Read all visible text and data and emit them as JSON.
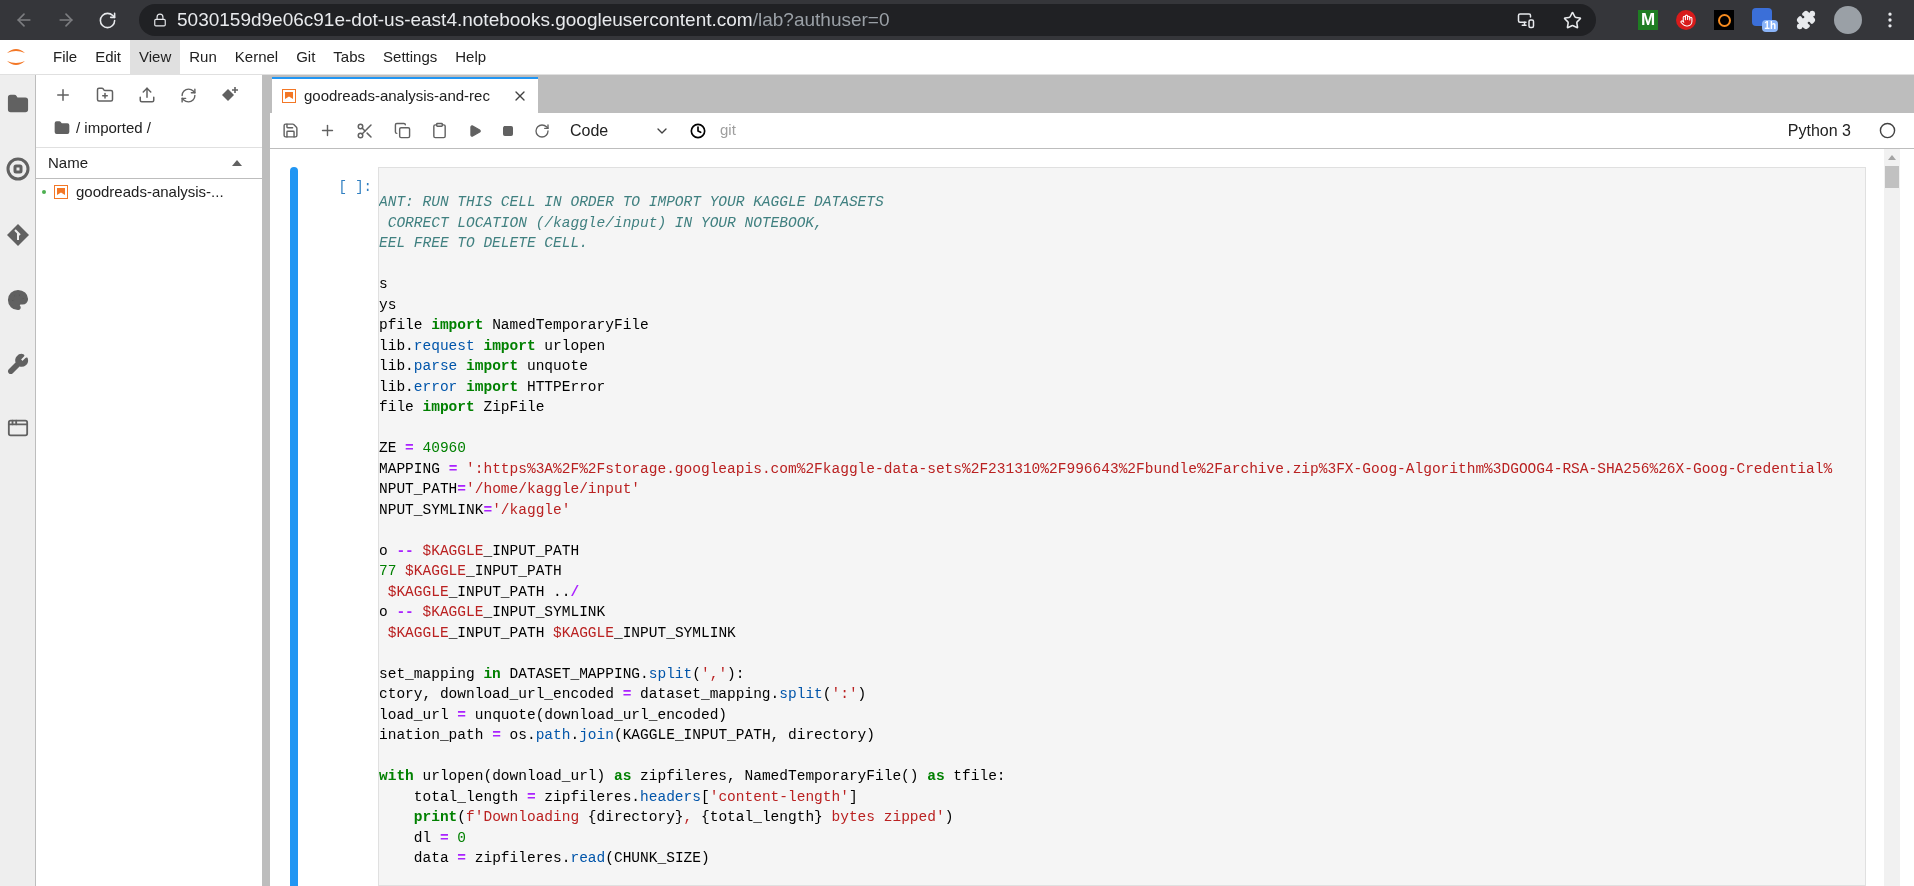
{
  "browser": {
    "url_host": "5030159d9e06c91e-dot-us-east4.notebooks.googleusercontent.com",
    "url_path": "/lab?authuser=0",
    "extensions": [
      {
        "kind": "letter",
        "text": "M"
      },
      {
        "kind": "hand"
      },
      {
        "kind": "ring"
      },
      {
        "kind": "calendar",
        "badge": "1h"
      },
      {
        "kind": "puzzle"
      }
    ]
  },
  "menu": [
    {
      "label": "File",
      "selected": false
    },
    {
      "label": "Edit",
      "selected": false
    },
    {
      "label": "View",
      "selected": true
    },
    {
      "label": "Run",
      "selected": false
    },
    {
      "label": "Kernel",
      "selected": false
    },
    {
      "label": "Git",
      "selected": false
    },
    {
      "label": "Tabs",
      "selected": false
    },
    {
      "label": "Settings",
      "selected": false
    },
    {
      "label": "Help",
      "selected": false
    }
  ],
  "file_browser": {
    "breadcrumb": "/ imported /",
    "column": "Name",
    "items": [
      {
        "name": "goodreads-analysis-...",
        "running": true
      }
    ]
  },
  "tabs": [
    {
      "label": "goodreads-analysis-and-rec",
      "selected": true
    }
  ],
  "toolbar": {
    "cell_type": "Code",
    "git": "git",
    "kernel": "Python 3"
  },
  "cell": {
    "prompt": "[ ]:",
    "lines": [
      {
        "kind": "code",
        "tokens": [
          {
            "text": "ANT: RUN THIS CELL IN ORDER TO IMPORT YOUR KAGGLE DATASETS",
            "kind": "comment"
          }
        ]
      },
      {
        "kind": "code",
        "tokens": [
          {
            "text": " CORRECT LOCATION (/kaggle/input) IN YOUR NOTEBOOK,",
            "kind": "comment"
          }
        ]
      },
      {
        "kind": "code",
        "tokens": [
          {
            "text": "EEL FREE TO DELETE CELL.",
            "kind": "comment"
          }
        ]
      },
      {
        "kind": "blank"
      },
      {
        "kind": "code",
        "tokens": [
          {
            "text": "s",
            "kind": "plain"
          }
        ]
      },
      {
        "kind": "code",
        "tokens": [
          {
            "text": "ys",
            "kind": "plain"
          }
        ]
      },
      {
        "kind": "code",
        "tokens": [
          {
            "text": "pfile ",
            "kind": "plain"
          },
          {
            "text": "import",
            "kind": "keyword"
          },
          {
            "text": " NamedTemporaryFile",
            "kind": "plain"
          }
        ]
      },
      {
        "kind": "code",
        "tokens": [
          {
            "text": "lib.",
            "kind": "plain"
          },
          {
            "text": "request ",
            "kind": "attr"
          },
          {
            "text": "import",
            "kind": "keyword"
          },
          {
            "text": " urlopen",
            "kind": "plain"
          }
        ]
      },
      {
        "kind": "code",
        "tokens": [
          {
            "text": "lib.",
            "kind": "plain"
          },
          {
            "text": "parse ",
            "kind": "attr"
          },
          {
            "text": "import",
            "kind": "keyword"
          },
          {
            "text": " unquote",
            "kind": "plain"
          }
        ]
      },
      {
        "kind": "code",
        "tokens": [
          {
            "text": "lib.",
            "kind": "plain"
          },
          {
            "text": "error ",
            "kind": "attr"
          },
          {
            "text": "import",
            "kind": "keyword"
          },
          {
            "text": " HTTPError",
            "kind": "plain"
          }
        ]
      },
      {
        "kind": "code",
        "tokens": [
          {
            "text": "file ",
            "kind": "plain"
          },
          {
            "text": "import",
            "kind": "keyword"
          },
          {
            "text": " ZipFile",
            "kind": "plain"
          }
        ]
      },
      {
        "kind": "blank"
      },
      {
        "kind": "code",
        "tokens": [
          {
            "text": "ZE ",
            "kind": "plain"
          },
          {
            "text": "= ",
            "kind": "operator"
          },
          {
            "text": "40960",
            "kind": "number"
          }
        ]
      },
      {
        "kind": "code",
        "tokens": [
          {
            "text": "MAPPING ",
            "kind": "plain"
          },
          {
            "text": "= ",
            "kind": "operator"
          },
          {
            "text": "':https%3A%2F%2Fstorage.googleapis.com%2Fkaggle-data-sets%2F231310%2F996643%2Fbundle%2Farchive.zip%3FX-Goog-Algorithm%3DGOOG4-RSA-SHA256%26X-Goog-Credential%",
            "kind": "string"
          }
        ]
      },
      {
        "kind": "code",
        "tokens": [
          {
            "text": "NPUT_PATH",
            "kind": "plain"
          },
          {
            "text": "=",
            "kind": "operator"
          },
          {
            "text": "'/home/kaggle/input'",
            "kind": "string"
          }
        ]
      },
      {
        "kind": "code",
        "tokens": [
          {
            "text": "NPUT_SYMLINK",
            "kind": "plain"
          },
          {
            "text": "=",
            "kind": "operator"
          },
          {
            "text": "'/kaggle'",
            "kind": "string"
          }
        ]
      },
      {
        "kind": "blank"
      },
      {
        "kind": "code",
        "tokens": [
          {
            "text": "o ",
            "kind": "plain"
          },
          {
            "text": "-- ",
            "kind": "operator"
          },
          {
            "text": "$KAGGLE",
            "kind": "string"
          },
          {
            "text": "_INPUT_PATH",
            "kind": "plain"
          }
        ]
      },
      {
        "kind": "code",
        "tokens": [
          {
            "text": "77 ",
            "kind": "number"
          },
          {
            "text": "$KAGGLE",
            "kind": "string"
          },
          {
            "text": "_INPUT_PATH",
            "kind": "plain"
          }
        ]
      },
      {
        "kind": "code",
        "tokens": [
          {
            "text": " $KAGGLE",
            "kind": "string"
          },
          {
            "text": "_INPUT_PATH ..",
            "kind": "plain"
          },
          {
            "text": "/",
            "kind": "operator"
          }
        ]
      },
      {
        "kind": "code",
        "tokens": [
          {
            "text": "o ",
            "kind": "plain"
          },
          {
            "text": "-- ",
            "kind": "operator"
          },
          {
            "text": "$KAGGLE",
            "kind": "string"
          },
          {
            "text": "_INPUT_SYMLINK",
            "kind": "plain"
          }
        ]
      },
      {
        "kind": "code",
        "tokens": [
          {
            "text": " $KAGGLE",
            "kind": "string"
          },
          {
            "text": "_INPUT_PATH ",
            "kind": "plain"
          },
          {
            "text": "$KAGGLE",
            "kind": "string"
          },
          {
            "text": "_INPUT_SYMLINK",
            "kind": "plain"
          }
        ]
      },
      {
        "kind": "blank"
      },
      {
        "kind": "code",
        "tokens": [
          {
            "text": "set_mapping ",
            "kind": "plain"
          },
          {
            "text": "in",
            "kind": "keyword"
          },
          {
            "text": " DATASET_MAPPING.",
            "kind": "plain"
          },
          {
            "text": "split",
            "kind": "attr"
          },
          {
            "text": "(",
            "kind": "plain"
          },
          {
            "text": "','",
            "kind": "string"
          },
          {
            "text": "):",
            "kind": "plain"
          }
        ]
      },
      {
        "kind": "code",
        "tokens": [
          {
            "text": "ctory, download_url_encoded ",
            "kind": "plain"
          },
          {
            "text": "=",
            "kind": "operator"
          },
          {
            "text": " dataset_mapping.",
            "kind": "plain"
          },
          {
            "text": "split",
            "kind": "attr"
          },
          {
            "text": "(",
            "kind": "plain"
          },
          {
            "text": "':'",
            "kind": "string"
          },
          {
            "text": ")",
            "kind": "plain"
          }
        ]
      },
      {
        "kind": "code",
        "tokens": [
          {
            "text": "load_url ",
            "kind": "plain"
          },
          {
            "text": "=",
            "kind": "operator"
          },
          {
            "text": " unquote(download_url_encoded)",
            "kind": "plain"
          }
        ]
      },
      {
        "kind": "code",
        "tokens": [
          {
            "text": "ination_path ",
            "kind": "plain"
          },
          {
            "text": "=",
            "kind": "operator"
          },
          {
            "text": " os.",
            "kind": "plain"
          },
          {
            "text": "path",
            "kind": "attr"
          },
          {
            "text": ".",
            "kind": "plain"
          },
          {
            "text": "join",
            "kind": "attr"
          },
          {
            "text": "(KAGGLE_INPUT_PATH, directory)",
            "kind": "plain"
          }
        ]
      },
      {
        "kind": "blank"
      },
      {
        "kind": "code",
        "tokens": [
          {
            "text": "with",
            "kind": "keyword"
          },
          {
            "text": " urlopen(download_url) ",
            "kind": "plain"
          },
          {
            "text": "as",
            "kind": "keyword"
          },
          {
            "text": " zipfileres, NamedTemporaryFile() ",
            "kind": "plain"
          },
          {
            "text": "as",
            "kind": "keyword"
          },
          {
            "text": " tfile:",
            "kind": "plain"
          }
        ]
      },
      {
        "kind": "code",
        "tokens": [
          {
            "text": "    total_length ",
            "kind": "plain"
          },
          {
            "text": "=",
            "kind": "operator"
          },
          {
            "text": " zipfileres.",
            "kind": "plain"
          },
          {
            "text": "headers",
            "kind": "attr"
          },
          {
            "text": "[",
            "kind": "plain"
          },
          {
            "text": "'content-length'",
            "kind": "string"
          },
          {
            "text": "]",
            "kind": "plain"
          }
        ]
      },
      {
        "kind": "code",
        "tokens": [
          {
            "text": "    print",
            "kind": "keyword"
          },
          {
            "text": "(",
            "kind": "plain"
          },
          {
            "text": "f'Downloading ",
            "kind": "string"
          },
          {
            "text": "{directory}",
            "kind": "plain"
          },
          {
            "text": ", ",
            "kind": "string"
          },
          {
            "text": "{total_length}",
            "kind": "plain"
          },
          {
            "text": " bytes zipped'",
            "kind": "string"
          },
          {
            "text": ")",
            "kind": "plain"
          }
        ]
      },
      {
        "kind": "code",
        "tokens": [
          {
            "text": "    dl ",
            "kind": "plain"
          },
          {
            "text": "= ",
            "kind": "operator"
          },
          {
            "text": "0",
            "kind": "number"
          }
        ]
      },
      {
        "kind": "code",
        "tokens": [
          {
            "text": "    data ",
            "kind": "plain"
          },
          {
            "text": "=",
            "kind": "operator"
          },
          {
            "text": " zipfileres.",
            "kind": "plain"
          },
          {
            "text": "read",
            "kind": "attr"
          },
          {
            "text": "(CHUNK_SIZE)",
            "kind": "plain"
          }
        ]
      }
    ]
  }
}
